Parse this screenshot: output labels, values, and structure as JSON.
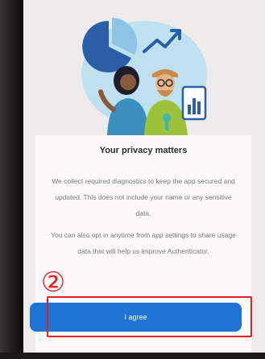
{
  "dialog": {
    "title": "Your privacy matters",
    "paragraph_1": "We collect required diagnostics to keep the app secured and updated. This does not include your name or any sensitive data.",
    "paragraph_2": "You can also opt in anytime from app settings to share usage data that will help us improve Authenticator.",
    "agree_label": "I agree"
  },
  "annotation": {
    "step_marker": "②"
  },
  "colors": {
    "accent": "#1f73d3",
    "highlight": "#e61f26",
    "screen_bg": "#eeeceb",
    "card_bg": "#fbfaf9"
  },
  "icons": [
    "pie-chart-icon",
    "trend-arrow-icon",
    "clipboard-chart-icon",
    "key-icon"
  ]
}
